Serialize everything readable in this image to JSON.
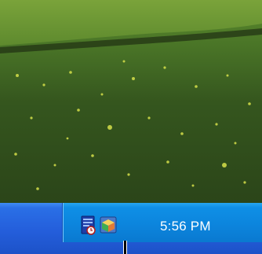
{
  "taskbar": {
    "clock": "5:56 PM"
  },
  "tray_icons": [
    {
      "name": "server-monitor-icon"
    },
    {
      "name": "network-package-icon"
    }
  ],
  "colors": {
    "taskbar": "#245edb",
    "tray": "#0c85dd",
    "grass": "#3a5a1e",
    "flowers": "#d6e04a"
  }
}
